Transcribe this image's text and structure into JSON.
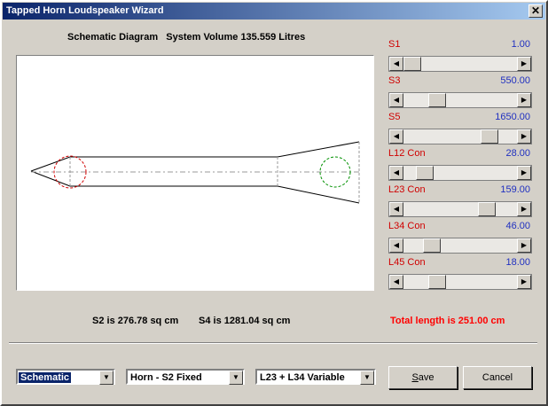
{
  "window": {
    "title": "Tapped Horn Loudspeaker Wizard",
    "close": "✕"
  },
  "diagram": {
    "label": "Schematic Diagram",
    "volume": "System Volume 135.559 Litres"
  },
  "params": [
    {
      "name": "S1",
      "value": "1.00",
      "fraction": 0.0
    },
    {
      "name": "S3",
      "value": "550.00",
      "fraction": 0.26
    },
    {
      "name": "S5",
      "value": "1650.00",
      "fraction": 0.82
    },
    {
      "name": "L12  Con",
      "value": "28.00",
      "fraction": 0.13
    },
    {
      "name": "L23  Con",
      "value": "159.00",
      "fraction": 0.79
    },
    {
      "name": "L34  Con",
      "value": "46.00",
      "fraction": 0.21
    },
    {
      "name": "L45  Con",
      "value": "18.00",
      "fraction": 0.26
    }
  ],
  "info": {
    "s2": "S2 is 276.78 sq cm",
    "s4": "S4 is 1281.04 sq cm",
    "total": "Total length is 251.00 cm"
  },
  "controls": {
    "view_select": "Schematic",
    "horn_select": "Horn - S2 Fixed",
    "variable_select": "L23 + L34 Variable",
    "save_prefix": "S",
    "save_rest": "ave",
    "cancel": "Cancel"
  },
  "colors": {
    "param_name": "#d00000",
    "param_value": "#2030c0",
    "total": "#ff0000",
    "title_bar": "#0a246a"
  }
}
